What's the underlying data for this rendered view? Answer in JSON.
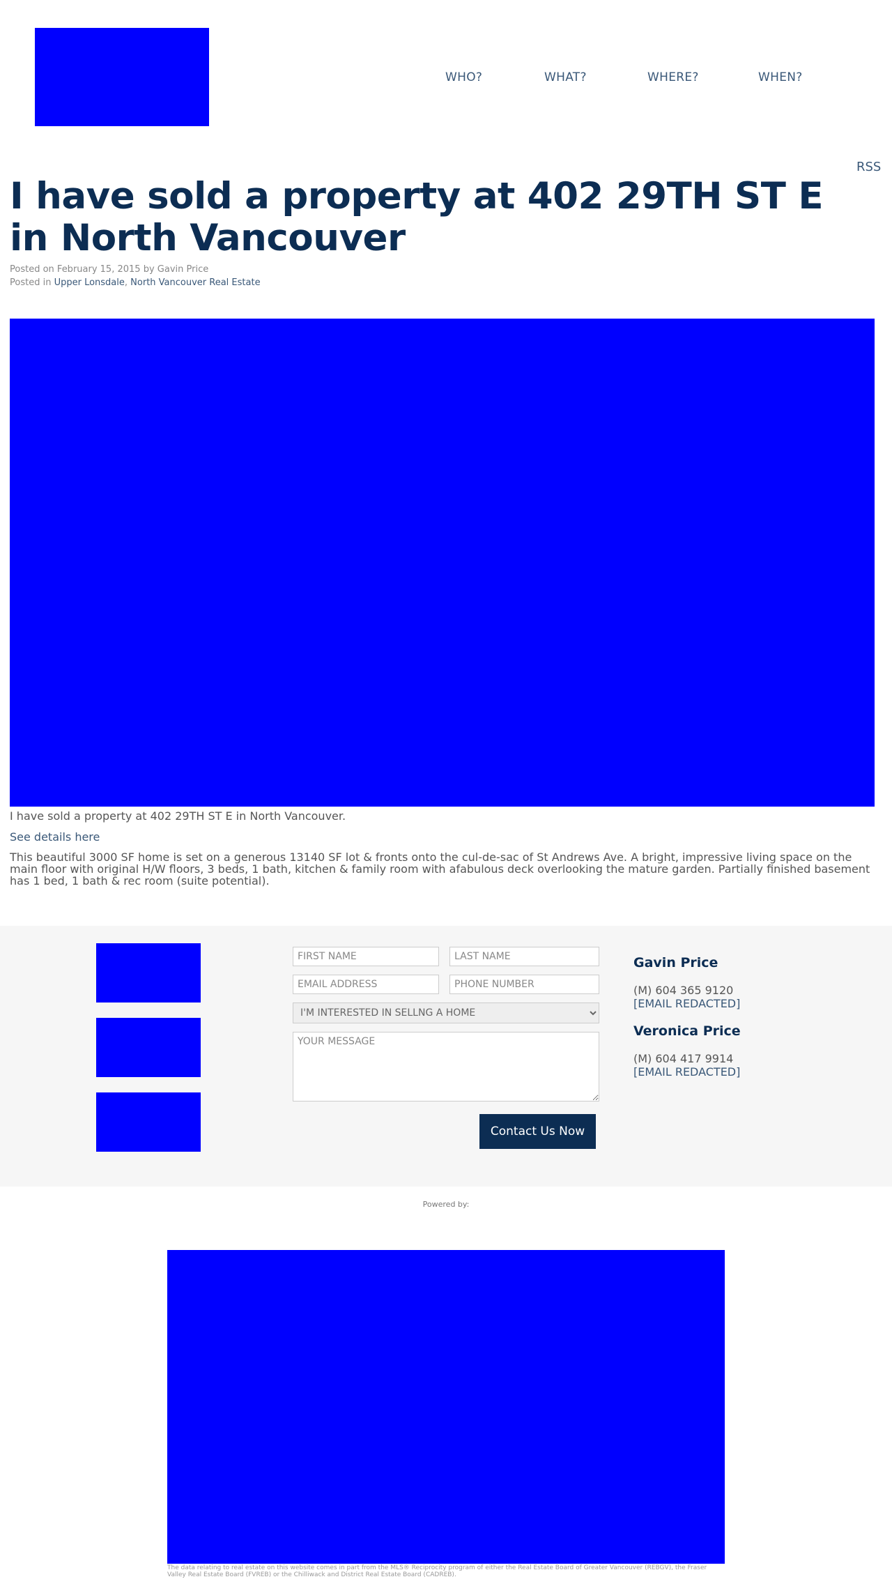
{
  "header": {
    "logo_icon": "site-logo",
    "nav": [
      "WHO?",
      "WHAT?",
      "WHERE?",
      "WHEN?"
    ],
    "rss": "RSS"
  },
  "post": {
    "title": "I have sold a property at 402 29TH ST E in North Vancouver",
    "posted_on_label": "Posted on",
    "date": "February 15, 2015",
    "by_label": "by",
    "author": "Gavin Price",
    "posted_in_label": "Posted in",
    "categories": [
      "Upper Lonsdale",
      "North Vancouver Real Estate"
    ],
    "category_separator": ",",
    "caption": "I have sold a property at 402 29TH ST E in North Vancouver.",
    "details_link": "See details here",
    "description": "This beautiful 3000 SF home is set on a generous 13140 SF lot & fronts onto the cul-de-sac of St Andrews Ave. A bright, impressive living space on the main floor with original H/W floors, 3 beds, 1 bath, kitchen & family room with afabulous deck overlooking the mature garden. Partially finished basement has 1 bed, 1 bath & rec room (suite potential)."
  },
  "contact": {
    "first_name_placeholder": "FIRST NAME",
    "last_name_placeholder": "LAST NAME",
    "email_placeholder": "EMAIL ADDRESS",
    "phone_placeholder": "PHONE NUMBER",
    "interest_selected": "I'M INTERESTED IN SELLNG A HOME",
    "message_placeholder": "YOUR MESSAGE",
    "submit_label": "Contact Us Now",
    "agents": [
      {
        "name": "Gavin Price",
        "phone": "(M) 604 365 9120",
        "email": "[EMAIL REDACTED]"
      },
      {
        "name": "Veronica Price",
        "phone": "(M) 604 417 9914",
        "email": "[EMAIL REDACTED]"
      }
    ]
  },
  "footer": {
    "powered_by": "Powered by:",
    "disclaimer": "The data relating to real estate on this website comes in part from the MLS® Reciprocity program of either the Real Estate Board of Greater Vancouver (REBGV), the Fraser Valley Real Estate Board (FVREB) or the Chilliwack and District Real Estate Board (CADREB)."
  },
  "colors": {
    "heading": "#0c2d53",
    "link": "#3a5878",
    "placeholder_image": "#0000ff",
    "section_bg": "#f6f6f6",
    "button_bg": "#0c2d53"
  }
}
